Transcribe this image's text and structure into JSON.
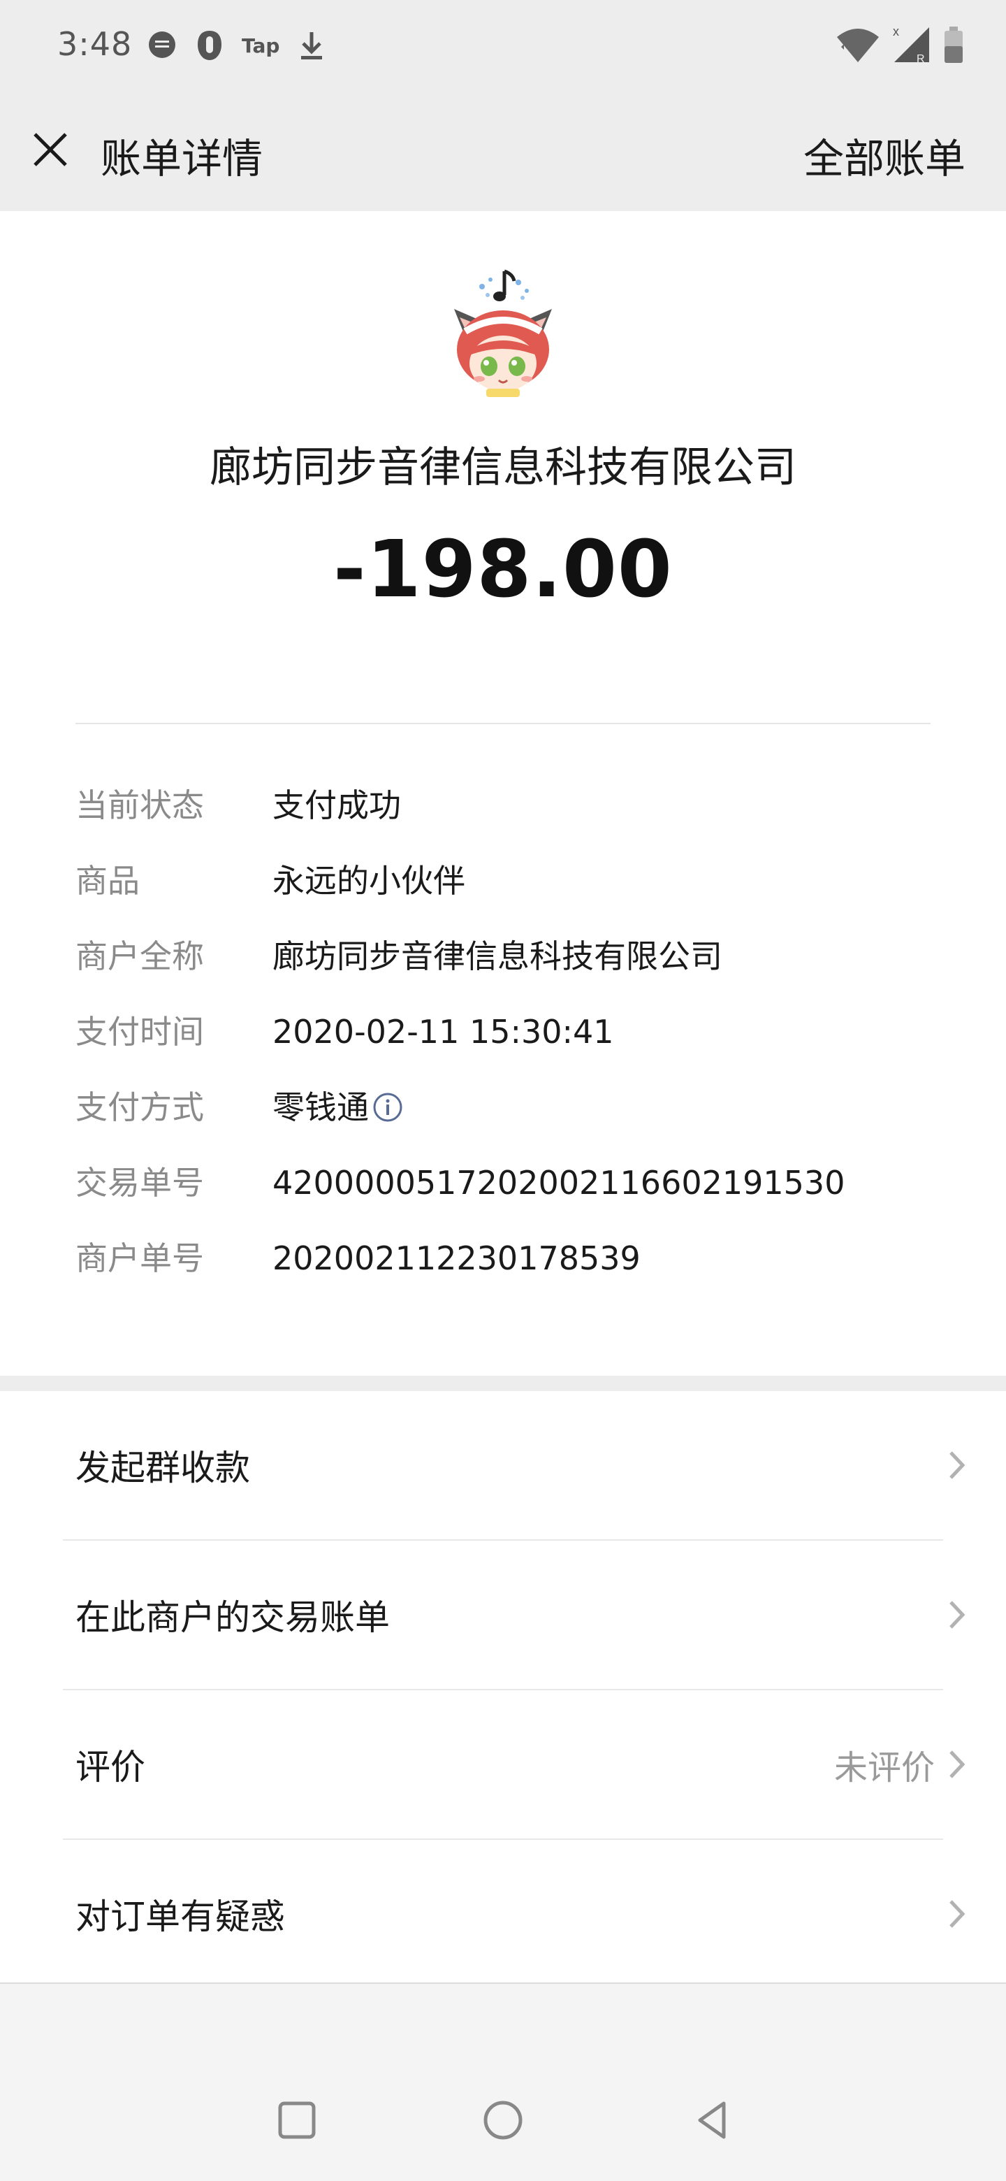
{
  "status_bar": {
    "time": "3:48",
    "tap_label": "Tap",
    "left_icons": [
      "message-icon",
      "alarm-icon",
      "tap-icon",
      "download-icon"
    ],
    "right_icons": [
      "wifi-icon",
      "signal-icon",
      "battery-icon"
    ],
    "signal_marks": "x",
    "roaming_mark": "R"
  },
  "nav": {
    "title": "账单详情",
    "right_label": "全部账单"
  },
  "transaction": {
    "merchant_title": "廊坊同步音律信息科技有限公司",
    "amount": "-198.00",
    "details": [
      {
        "label": "当前状态",
        "value": "支付成功"
      },
      {
        "label": "商品",
        "value": "永远的小伙伴"
      },
      {
        "label": "商户全称",
        "value": "廊坊同步音律信息科技有限公司"
      },
      {
        "label": "支付时间",
        "value": "2020-02-11 15:30:41"
      },
      {
        "label": "支付方式",
        "value": "零钱通"
      },
      {
        "label": "交易单号",
        "value": "4200000517202002116602191530"
      },
      {
        "label": "商户单号",
        "value": "202002112230178539"
      }
    ]
  },
  "actions": [
    {
      "label": "发起群收款",
      "extra": ""
    },
    {
      "label": "在此商户的交易账单",
      "extra": ""
    },
    {
      "label": "评价",
      "extra": "未评价"
    },
    {
      "label": "对订单有疑惑",
      "extra": ""
    }
  ],
  "colors": {
    "background": "#ededed",
    "card": "#ffffff",
    "label_gray": "#8a8a8a",
    "link_blue": "#576b95"
  }
}
